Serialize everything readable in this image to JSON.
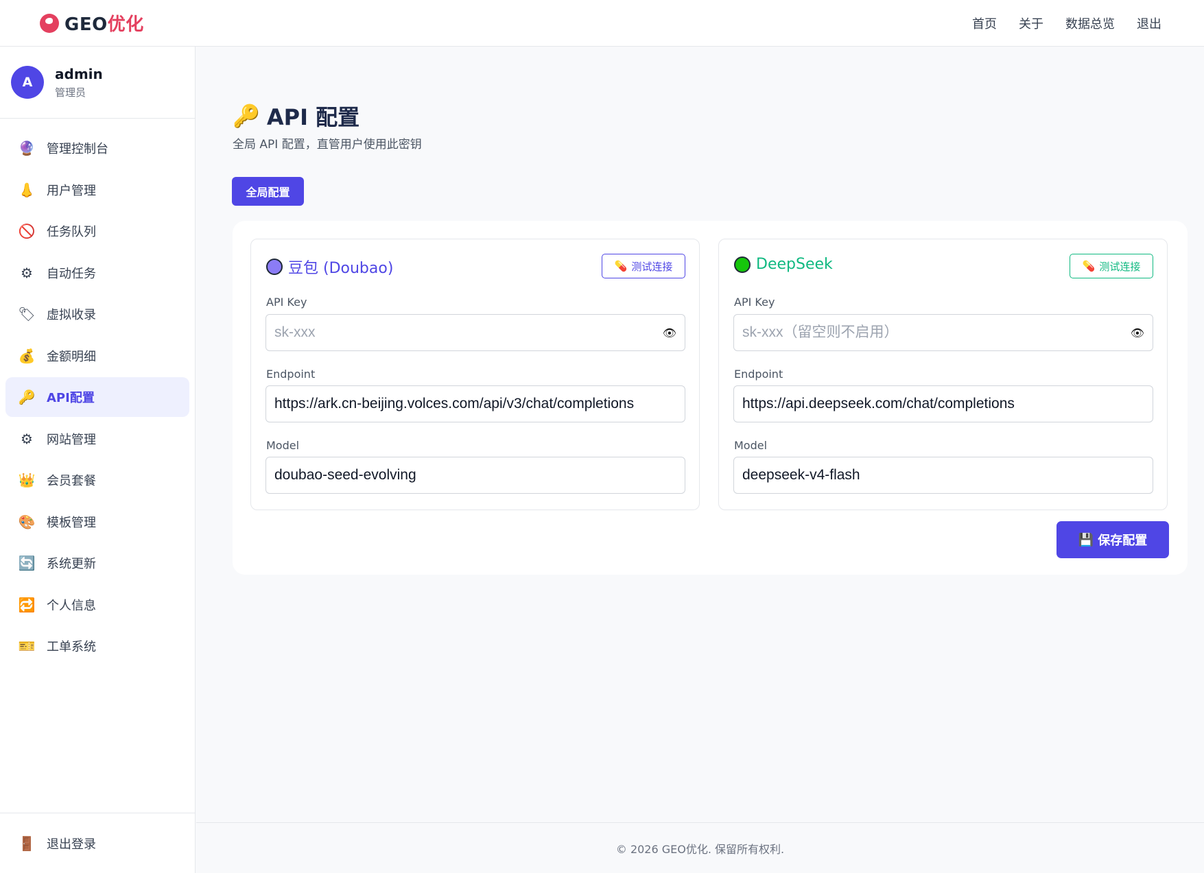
{
  "brand": {
    "prefix": "GEO",
    "accent": "优化"
  },
  "topnav": [
    "首页",
    "关于",
    "数据总览",
    "退出"
  ],
  "user": {
    "initial": "A",
    "name": "admin",
    "role": "管理员"
  },
  "sidebar": {
    "items": [
      {
        "label": "管理控制台",
        "icon": "🔮",
        "icon_name": "crystal-ball-icon"
      },
      {
        "label": "用户管理",
        "icon": "👃",
        "icon_name": "users-icon"
      },
      {
        "label": "任务队列",
        "icon": "🚫",
        "icon_name": "task-queue-icon"
      },
      {
        "label": "自动任务",
        "icon": "⚙",
        "icon_name": "gear-icon"
      },
      {
        "label": "虚拟收录",
        "icon": "🏷",
        "icon_name": "tag-icon"
      },
      {
        "label": "金额明细",
        "icon": "💰",
        "icon_name": "money-bag-icon"
      },
      {
        "label": "API配置",
        "icon": "🔑",
        "icon_name": "key-icon",
        "active": true
      },
      {
        "label": "网站管理",
        "icon": "⚙",
        "icon_name": "gear-icon"
      },
      {
        "label": "会员套餐",
        "icon": "👑",
        "icon_name": "crown-icon"
      },
      {
        "label": "模板管理",
        "icon": "🎨",
        "icon_name": "palette-icon"
      },
      {
        "label": "系统更新",
        "icon": "🔄",
        "icon_name": "refresh-icon"
      },
      {
        "label": "个人信息",
        "icon": "🔁",
        "icon_name": "repeat-icon"
      },
      {
        "label": "工单系统",
        "icon": "🎫",
        "icon_name": "ticket-icon"
      }
    ],
    "logout_label": "退出登录",
    "logout_icon": "🚪"
  },
  "page": {
    "title": "API 配置",
    "title_icon": "🔑",
    "subtitle": "全局 API 配置，直管用户使用此密钥",
    "tab_label": "全局配置"
  },
  "providers": [
    {
      "name": "豆包 (Doubao)",
      "color": "#4f46e5",
      "dot_color": "#8b7cf6",
      "test_label": "测试连接",
      "api_key_label": "API Key",
      "api_key_placeholder": "sk-xxx",
      "endpoint_label": "Endpoint",
      "endpoint": "https://ark.cn-beijing.volces.com/api/v3/chat/completions",
      "model_label": "Model",
      "model": "doubao-seed-evolving"
    },
    {
      "name": "DeepSeek",
      "color": "#10b981",
      "dot_color": "#16c60c",
      "test_label": "测试连接",
      "api_key_label": "API Key",
      "api_key_placeholder": "sk-xxx（留空则不启用）",
      "endpoint_label": "Endpoint",
      "endpoint": "https://api.deepseek.com/chat/completions",
      "model_label": "Model",
      "model": "deepseek-v4-flash"
    }
  ],
  "save_label": "保存配置",
  "save_icon": "💾",
  "footer": "© 2026 GEO优化. 保留所有权利."
}
